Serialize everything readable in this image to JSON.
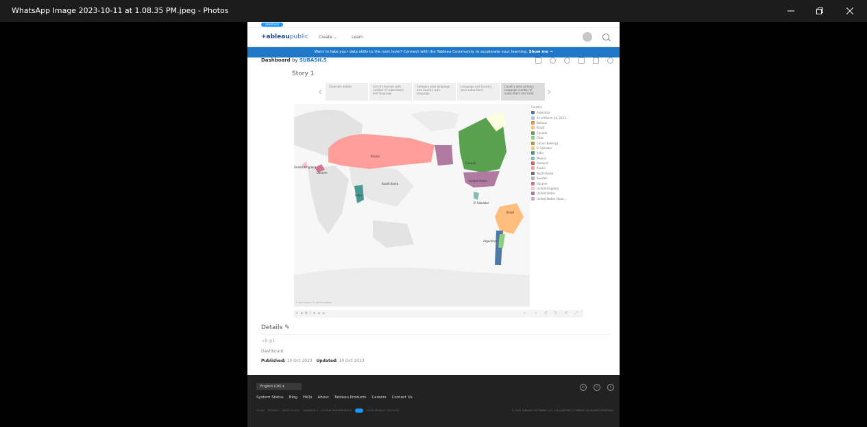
{
  "window": {
    "title": "WhatsApp Image 2023-10-11 at 1.08.35 PM.jpeg - Photos"
  },
  "site": {
    "brand": "salesforce",
    "logo_main": "+ableau",
    "logo_sub": "public",
    "nav": [
      "Create",
      "Learn"
    ],
    "banner_text": "Want to take your data skills to the next level? Connect with the Tableau Community to accelerate your learning.",
    "banner_link": "Show me →"
  },
  "dashboard": {
    "label": "Dashboard",
    "by": "by",
    "author": "SUBASH.S"
  },
  "story": {
    "title": "Story 1",
    "points": [
      "Channels details",
      "List of channels with number of subscribers and language",
      "Category wise language and country wise language",
      "Language and country wise subscribers",
      "Country wise primary language number of subscribers and total"
    ],
    "active_point": 4
  },
  "map": {
    "labels": [
      "Russia",
      "Canada",
      "United States",
      "South Korea",
      "United Kingdom",
      "Ukraine",
      "Brazil",
      "Argentina",
      "El Salvador",
      "India"
    ],
    "attribution": "© 2023 Mapbox © OpenStreetMap",
    "legend_title": "Country",
    "legend": [
      {
        "name": "Argentina",
        "color": "#4e79a7"
      },
      {
        "name": "As of March 14, 2023...",
        "color": "#a0cbe8"
      },
      {
        "name": "Belarus",
        "color": "#f28e2b"
      },
      {
        "name": "Brazil",
        "color": "#ffbe7d"
      },
      {
        "name": "Canada",
        "color": "#59a14f"
      },
      {
        "name": "Chile",
        "color": "#8cd17d"
      },
      {
        "name": "Cocos (Keeling)...",
        "color": "#b6992d"
      },
      {
        "name": "El Salvador",
        "color": "#f1ce63"
      },
      {
        "name": "India",
        "color": "#499894"
      },
      {
        "name": "Mexico",
        "color": "#86bcb6"
      },
      {
        "name": "Romania",
        "color": "#e15759"
      },
      {
        "name": "Russia",
        "color": "#ff9d9a"
      },
      {
        "name": "South Korea",
        "color": "#79706e"
      },
      {
        "name": "Sweden",
        "color": "#bab0ac"
      },
      {
        "name": "Ukraine",
        "color": "#d37295"
      },
      {
        "name": "United Kingdom",
        "color": "#fabfd2"
      },
      {
        "name": "United States",
        "color": "#b07aa1"
      },
      {
        "name": "United States (Yuan...",
        "color": "#d4a6c8"
      }
    ]
  },
  "vizfooter": {
    "brand": "+ a b l e a u"
  },
  "details": {
    "title": "Details",
    "favorites": "0",
    "views": "1",
    "kind": "Dashboard",
    "published_label": "Published:",
    "published": "10 Oct 2023",
    "updated_label": "Updated:",
    "updated": "10 Oct 2023"
  },
  "footer": {
    "language": "English (UK)",
    "links": [
      "System Status",
      "Blog",
      "FAQs",
      "About",
      "Tableau Products",
      "Careers",
      "Contact Us"
    ],
    "legal": [
      "LEGAL",
      "PRIVACY",
      "DATA POLICY",
      "UNINSTALL",
      "COOKIE PREFERENCES",
      "YOUR PRIVACY CHOICES"
    ],
    "copyright": "© 2023 TABLEAU SOFTWARE, LLC, A SALESFORCE COMPANY. ALL RIGHTS RESERVED."
  }
}
